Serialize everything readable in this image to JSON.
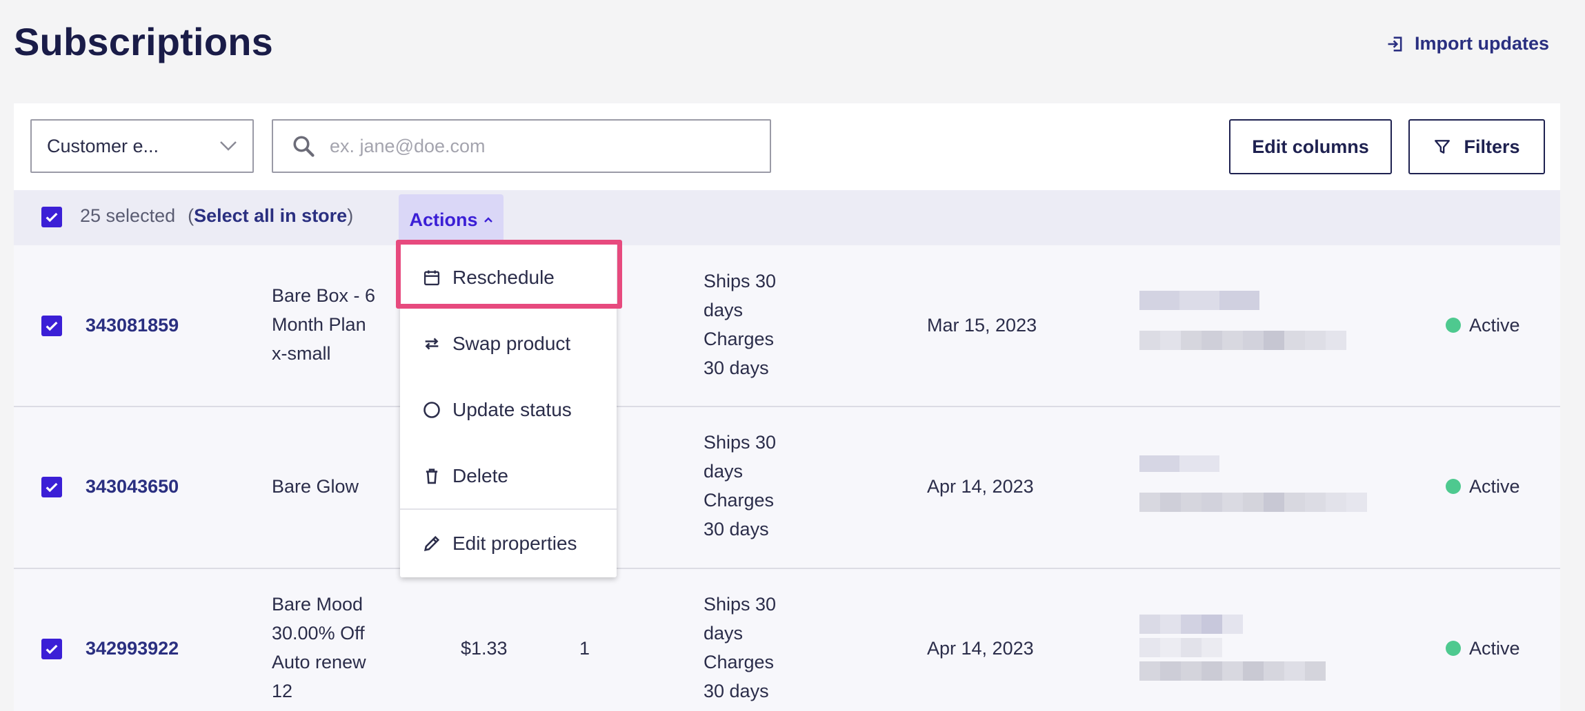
{
  "page": {
    "title": "Subscriptions",
    "import_label": "Import updates"
  },
  "toolbar": {
    "filter_field": "Customer e...",
    "search_placeholder": "ex. jane@doe.com",
    "edit_columns_label": "Edit columns",
    "filters_label": "Filters"
  },
  "bulk": {
    "count_label": "25 selected",
    "select_all_label": "Select all in store",
    "actions_label": "Actions"
  },
  "menu": {
    "items": [
      {
        "label": "Reschedule",
        "icon": "calendar-icon"
      },
      {
        "label": "Swap product",
        "icon": "swap-arrows-icon"
      },
      {
        "label": "Update status",
        "icon": "circle-icon"
      },
      {
        "label": "Delete",
        "icon": "trash-icon"
      },
      {
        "label": "Edit properties",
        "icon": "pencil-icon"
      }
    ],
    "highlighted": "Reschedule"
  },
  "rows": [
    {
      "id": "343081859",
      "product": [
        "Bare Box - 6",
        "Month Plan",
        "x-small"
      ],
      "price": "",
      "quantity": "",
      "schedule": [
        "Ships 30",
        "days",
        "Charges",
        "30 days"
      ],
      "next_date": "Mar 15, 2023",
      "status": "Active"
    },
    {
      "id": "343043650",
      "product": [
        "Bare Glow"
      ],
      "price": "",
      "quantity": "",
      "schedule": [
        "Ships 30",
        "days",
        "Charges",
        "30 days"
      ],
      "next_date": "Apr 14, 2023",
      "status": "Active"
    },
    {
      "id": "342993922",
      "product": [
        "Bare Mood",
        "30.00% Off",
        "Auto renew",
        "12"
      ],
      "price": "$1.33",
      "quantity": "1",
      "schedule": [
        "Ships 30",
        "days",
        "Charges",
        "30 days"
      ],
      "next_date": "Apr 14, 2023",
      "status": "Active"
    }
  ],
  "colors": {
    "accent": "#3b1fd6",
    "navy": "#1e2150",
    "status_active": "#4ec98f",
    "highlight": "#e74a7e",
    "actions_bg": "#dad7f7"
  }
}
